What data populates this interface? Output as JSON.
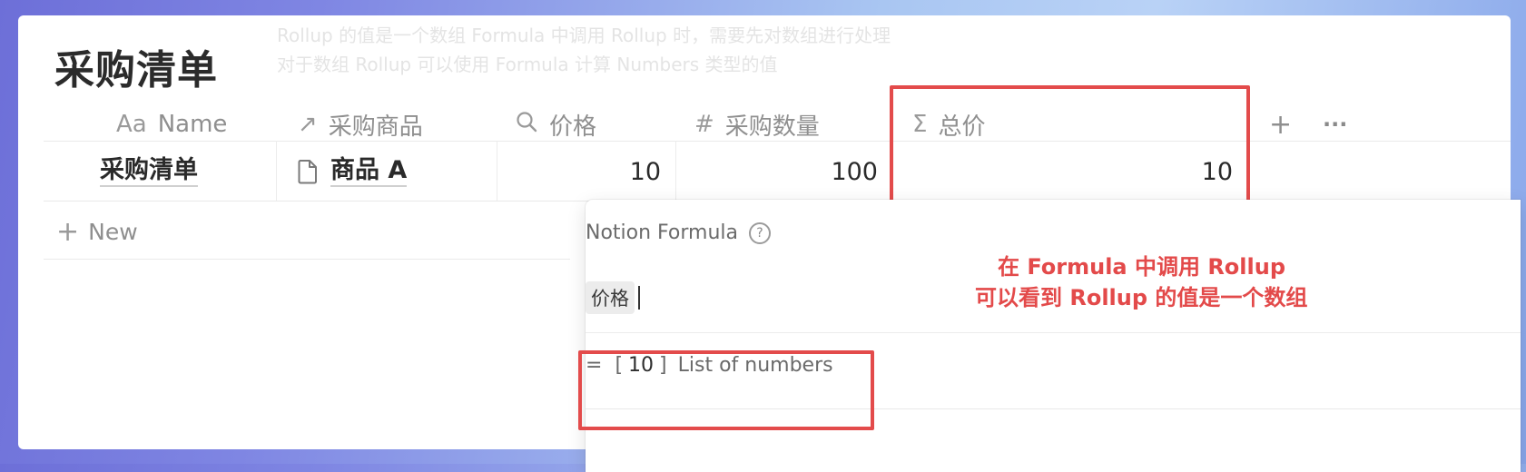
{
  "page": {
    "title": "采购清单"
  },
  "background_text": {
    "line1": "Rollup 的值是一个数组 Formula 中调用 Rollup 时，需要先对数组进行处理",
    "line2": "对于数组 Rollup 可以使用 Formula 计算 Numbers 类型的值"
  },
  "columns": [
    {
      "icon": "text-type-icon",
      "glyph": "Aa",
      "label": "Name"
    },
    {
      "icon": "relation-arrow-icon",
      "glyph": "↗",
      "label": "采购商品"
    },
    {
      "icon": "search-icon",
      "glyph": "",
      "label": "价格"
    },
    {
      "icon": "number-icon",
      "glyph": "#",
      "label": "采购数量"
    },
    {
      "icon": "sigma-icon",
      "glyph": "Σ",
      "label": "总价"
    }
  ],
  "row": {
    "name": "采购清单",
    "product": "商品 A",
    "price": "10",
    "quantity": "100",
    "total": "10"
  },
  "toolbar": {
    "add": "+",
    "more": "···"
  },
  "new_row_label": "New",
  "formula_panel": {
    "title": "Notion Formula",
    "help": "?",
    "token": "价格",
    "result_prefix": "=",
    "result_open": "[",
    "result_value": "10",
    "result_close": "]",
    "result_type": "List of numbers"
  },
  "annotation": {
    "line1": "在 Formula 中调用 Rollup",
    "line2": "可以看到 Rollup 的值是一个数组"
  },
  "colors": {
    "accent_red": "#e34b4b",
    "token_bg": "#ececec"
  }
}
